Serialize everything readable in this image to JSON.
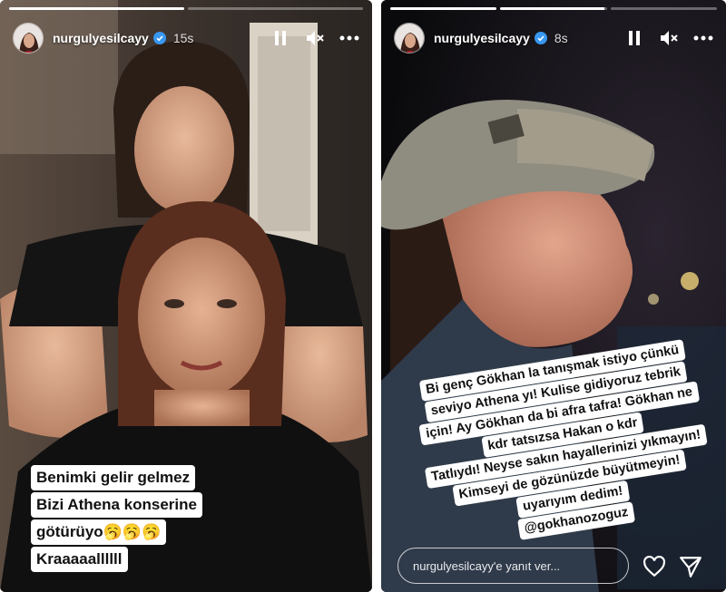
{
  "stories": [
    {
      "username": "nurgulyesilcayy",
      "time": "15s",
      "progress": [
        1.0,
        0.0
      ],
      "caption_lines": [
        "Benimki gelir gelmez",
        "Bizi Athena konserine",
        "götürüyo",
        "Kraaaaallllll"
      ],
      "emoji_after_line_3": "🥱🥱🥱"
    },
    {
      "username": "nurgulyesilcayy",
      "time": "8s",
      "progress": [
        1.0,
        0.98,
        0.0
      ],
      "caption_lines": [
        "Bi genç Gökhan la tanışmak istiyo çünkü",
        "seviyo Athena yı! Kulise gidiyoruz tebrik",
        "için! Ay Gökhan da bi afra tafra! Gökhan ne",
        "kdr tatsızsa Hakan o kdr",
        "Tatlıydı! Neyse sakın hayallerinizi yıkmayın!",
        "Kimseyi de gözünüzde büyütmeyin!",
        "uyarıyım dedim!",
        "@gokhanozoguz"
      ],
      "reply_placeholder": "nurgulyesilcayy'e yanıt ver..."
    }
  ],
  "icons": {
    "pause": "pause-icon",
    "mute": "speaker-muted-icon",
    "more": "more-horizontal-icon",
    "verified": "verified-badge-icon",
    "heart": "heart-icon",
    "share": "send-icon"
  },
  "colors": {
    "verified_blue": "#3897f0",
    "caption_bg": "#ffffff",
    "caption_text": "#111111"
  }
}
